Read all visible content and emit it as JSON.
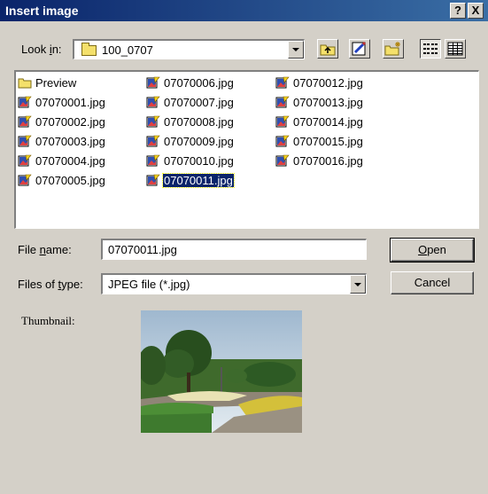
{
  "window": {
    "title": "Insert image",
    "help_btn": "?",
    "close_btn": "X"
  },
  "lookin": {
    "label_pre": "Look ",
    "label_u": "i",
    "label_post": "n:",
    "value": "100_0707"
  },
  "toolbar": {
    "icons": [
      "up-one-level-icon",
      "sketch-icon",
      "new-folder-icon",
      "list-view-icon",
      "details-view-icon"
    ]
  },
  "files": {
    "col1": [
      "Preview",
      "07070001.jpg",
      "07070002.jpg",
      "07070003.jpg",
      "07070004.jpg",
      "07070005.jpg"
    ],
    "col2": [
      "07070006.jpg",
      "07070007.jpg",
      "07070008.jpg",
      "07070009.jpg",
      "07070010.jpg",
      "07070011.jpg"
    ],
    "col3": [
      "07070012.jpg",
      "07070013.jpg",
      "07070014.jpg",
      "07070015.jpg",
      "07070016.jpg"
    ],
    "selected": "07070011.jpg"
  },
  "filename": {
    "label_pre": "File ",
    "label_u": "n",
    "label_post": "ame:",
    "value": "07070011.jpg"
  },
  "filetype": {
    "label_pre": "Files of ",
    "label_u": "t",
    "label_post": "ype:",
    "value": "JPEG file (*.jpg)"
  },
  "buttons": {
    "open_u": "O",
    "open_rest": "pen",
    "cancel": "Cancel"
  },
  "thumbnail": {
    "label": "Thumbnail:"
  },
  "colors": {
    "title_start": "#0a246a",
    "title_end": "#3a6ea5",
    "selection": "#0a246a",
    "face": "#d4d0c8"
  }
}
